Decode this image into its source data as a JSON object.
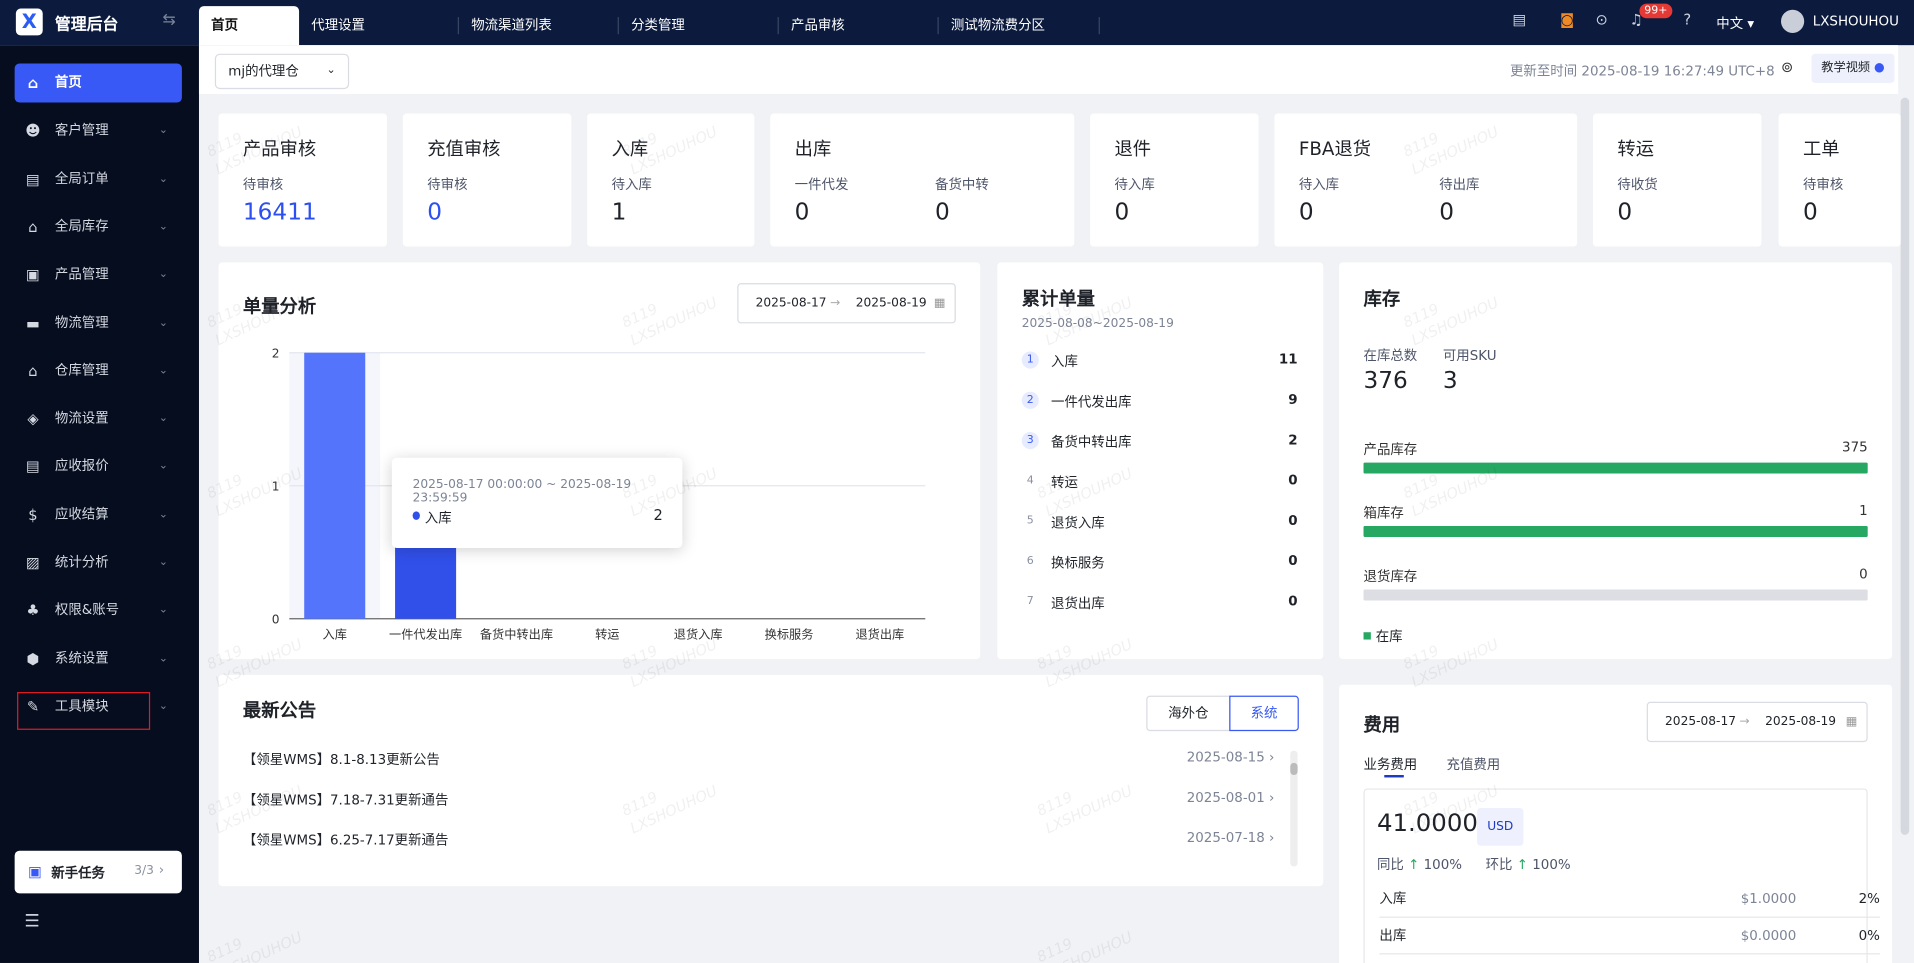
{
  "app": {
    "title": "管理后台",
    "logo": "X"
  },
  "tabs": [
    {
      "label": "首页"
    },
    {
      "label": "代理设置"
    },
    {
      "label": "物流渠道列表"
    },
    {
      "label": "分类管理"
    },
    {
      "label": "产品审核"
    },
    {
      "label": "测试物流费分区"
    }
  ],
  "header": {
    "notifications_badge": "99+",
    "language": "中文",
    "username": "LXSHOUHOU"
  },
  "sidebar": {
    "items": [
      {
        "label": "首页",
        "icon": "home-icon"
      },
      {
        "label": "客户管理",
        "icon": "users-icon"
      },
      {
        "label": "全局订单",
        "icon": "clipboard-icon"
      },
      {
        "label": "全局库存",
        "icon": "warehouse-icon"
      },
      {
        "label": "产品管理",
        "icon": "bag-icon"
      },
      {
        "label": "物流管理",
        "icon": "truck-icon"
      },
      {
        "label": "仓库管理",
        "icon": "building-icon"
      },
      {
        "label": "物流设置",
        "icon": "box-icon"
      },
      {
        "label": "应收报价",
        "icon": "document-icon"
      },
      {
        "label": "应收结算",
        "icon": "dollar-icon"
      },
      {
        "label": "统计分析",
        "icon": "chart-icon"
      },
      {
        "label": "权限&账号",
        "icon": "hierarchy-icon"
      },
      {
        "label": "系统设置",
        "icon": "gear-icon"
      },
      {
        "label": "工具模块",
        "icon": "wrench-icon"
      }
    ],
    "task": {
      "label": "新手任务",
      "progress": "3/3"
    }
  },
  "subbar": {
    "warehouse_select": "mj的代理仓",
    "updated": "更新至时间 2025-08-19 16:27:49 UTC+8",
    "tutorial": "教学视频"
  },
  "stats": [
    {
      "title": "产品审核",
      "items": [
        {
          "label": "待审核",
          "value": "16411",
          "highlight": true
        }
      ]
    },
    {
      "title": "充值审核",
      "items": [
        {
          "label": "待审核",
          "value": "0",
          "highlight": true
        }
      ]
    },
    {
      "title": "入库",
      "items": [
        {
          "label": "待入库",
          "value": "1"
        }
      ]
    },
    {
      "title": "出库",
      "items": [
        {
          "label": "一件代发",
          "value": "0"
        },
        {
          "label": "备货中转",
          "value": "0"
        }
      ]
    },
    {
      "title": "退件",
      "items": [
        {
          "label": "待入库",
          "value": "0"
        }
      ]
    },
    {
      "title": "FBA退货",
      "items": [
        {
          "label": "待入库",
          "value": "0"
        },
        {
          "label": "待出库",
          "value": "0"
        }
      ]
    },
    {
      "title": "转运",
      "items": [
        {
          "label": "待收货",
          "value": "0"
        }
      ]
    },
    {
      "title": "工单",
      "items": [
        {
          "label": "待审核",
          "value": "0"
        }
      ]
    }
  ],
  "analysis": {
    "title": "单量分析",
    "date_start": "2025-08-17",
    "date_end": "2025-08-19",
    "tooltip": {
      "range": "2025-08-17 00:00:00 ~ 2025-08-19 23:59:59",
      "series": "入库",
      "value": "2"
    }
  },
  "chart_data": {
    "type": "bar",
    "title": "单量分析",
    "categories": [
      "入库",
      "一件代发出库",
      "备货中转出库",
      "转运",
      "退货入库",
      "换标服务",
      "退货出库"
    ],
    "values": [
      2,
      1,
      0,
      0,
      0,
      0,
      0
    ],
    "ylim": [
      0,
      2
    ],
    "yticks": [
      "0",
      "1",
      "2"
    ],
    "grid": true
  },
  "cumulative": {
    "title": "累计单量",
    "range": "2025-08-08~2025-08-19",
    "items": [
      {
        "rank": "1",
        "label": "入库",
        "value": "11"
      },
      {
        "rank": "2",
        "label": "一件代发出库",
        "value": "9"
      },
      {
        "rank": "3",
        "label": "备货中转出库",
        "value": "2"
      },
      {
        "rank": "4",
        "label": "转运",
        "value": "0"
      },
      {
        "rank": "5",
        "label": "退货入库",
        "value": "0"
      },
      {
        "rank": "6",
        "label": "换标服务",
        "value": "0"
      },
      {
        "rank": "7",
        "label": "退货出库",
        "value": "0"
      }
    ]
  },
  "inventory": {
    "title": "库存",
    "total_label": "在库总数",
    "total": "376",
    "sku_label": "可用SKU",
    "sku": "3",
    "bars": [
      {
        "label": "产品库存",
        "value": "375",
        "fill": 1
      },
      {
        "label": "箱库存",
        "value": "1",
        "fill": 1
      },
      {
        "label": "退货库存",
        "value": "0",
        "fill": 0
      }
    ],
    "legend": "在库",
    "color": "#27a862"
  },
  "notices": {
    "title": "最新公告",
    "toggle": [
      "海外仓",
      "系统"
    ],
    "items": [
      {
        "text": "【领星WMS】8.1-8.13更新公告",
        "date": "2025-08-15"
      },
      {
        "text": "【领星WMS】7.18-7.31更新通告",
        "date": "2025-08-01"
      },
      {
        "text": "【领星WMS】6.25-7.17更新通告",
        "date": "2025-07-18"
      }
    ]
  },
  "fees": {
    "title": "费用",
    "date_start": "2025-08-17",
    "date_end": "2025-08-19",
    "tabs": [
      "业务费用",
      "充值费用"
    ],
    "total": "41.0000",
    "currency": "USD",
    "yoy_label": "同比",
    "yoy": "100%",
    "mom_label": "环比",
    "mom": "100%",
    "rows": [
      {
        "label": "入库",
        "amount": "$1.0000",
        "pct": "2%"
      },
      {
        "label": "出库",
        "amount": "$0.0000",
        "pct": "0%"
      }
    ]
  },
  "watermark": "8119\nLXSHOUHOU",
  "colors": {
    "accent": "#3859f5",
    "nav": "#0b1a3d",
    "success": "#27a862"
  }
}
